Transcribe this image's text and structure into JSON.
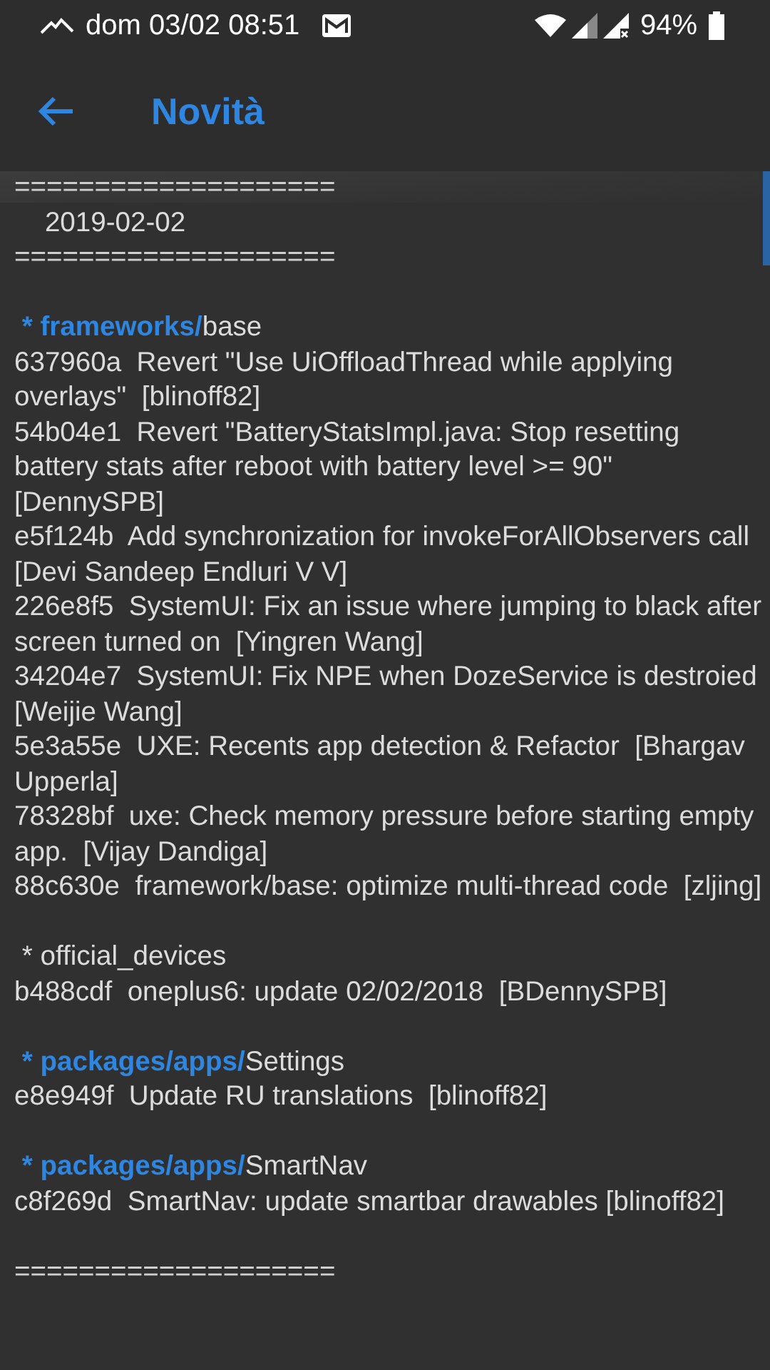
{
  "status_bar": {
    "time": "dom 03/02 08:51",
    "battery": "94%"
  },
  "app_bar": {
    "title": "Novità"
  },
  "changelog": {
    "header": [
      {
        "kind": "rule",
        "text": "===================="
      },
      {
        "kind": "date",
        "text": "2019-02-02"
      },
      {
        "kind": "rule",
        "text": "===================="
      }
    ],
    "sections": [
      {
        "marker": "*",
        "path": "frameworks/",
        "repo": "base",
        "commits": [
          "637960a  Revert \"Use UiOffloadThread while applying overlays\"  [blinoff82]",
          "54b04e1  Revert \"BatteryStatsImpl.java: Stop resetting battery stats after reboot with battery level >= 90\"  [DennySPB]",
          "e5f124b  Add synchronization for invokeForAllObservers call  [Devi Sandeep Endluri V V]",
          "226e8f5  SystemUI: Fix an issue where jumping to black after screen turned on  [Yingren Wang]",
          "34204e7  SystemUI: Fix NPE when DozeService is destroied  [Weijie Wang]",
          "5e3a55e  UXE: Recents app detection & Refactor  [Bhargav Upperla]",
          "78328bf  uxe: Check memory pressure before starting empty app.  [Vijay Dandiga]",
          "88c630e  framework/base: optimize multi-thread code  [zljing]"
        ]
      },
      {
        "marker": "*",
        "repo": "official_devices",
        "commits": [
          "b488cdf  oneplus6: update 02/02/2018  [BDennySPB]"
        ]
      },
      {
        "marker": "*",
        "path": "packages/apps/",
        "repo": "Settings",
        "commits": [
          "e8e949f  Update RU translations  [blinoff82]"
        ]
      },
      {
        "marker": "*",
        "path": "packages/apps/",
        "repo": "SmartNav",
        "commits": [
          "c8f269d  SmartNav: update smartbar drawables [blinoff82]"
        ]
      }
    ],
    "footer": [
      {
        "kind": "rule",
        "text": "===================="
      }
    ]
  }
}
